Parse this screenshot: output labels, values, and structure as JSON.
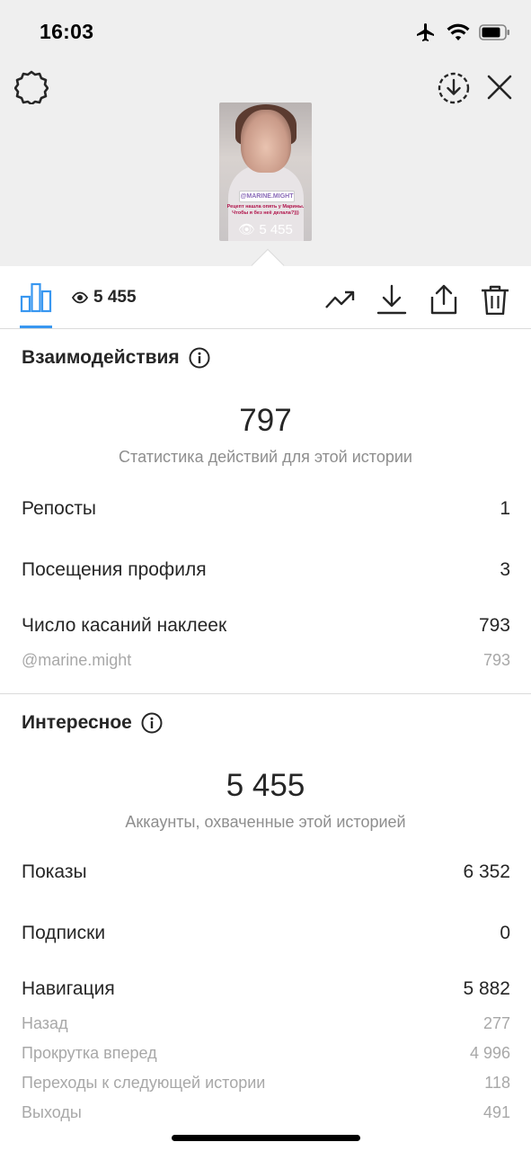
{
  "status_bar": {
    "time": "16:03"
  },
  "story": {
    "thumb_tag": "@MARINE.MIGHT",
    "thumb_caption": "Рецепт нашла опять у Марины. Чтобы я без неё делала?)))",
    "thumb_views": "5 455"
  },
  "toolbar": {
    "views": "5 455"
  },
  "interactions": {
    "title": "Взаимодействия",
    "total": "797",
    "total_label": "Статистика действий для этой истории",
    "rows": [
      {
        "label": "Репосты",
        "value": "1"
      },
      {
        "label": "Посещения профиля",
        "value": "3"
      },
      {
        "label": "Число касаний наклеек",
        "value": "793"
      }
    ],
    "sub_rows": [
      {
        "label": "@marine.might",
        "value": "793"
      }
    ]
  },
  "discovery": {
    "title": "Интересное",
    "total": "5 455",
    "total_label": "Аккаунты, охваченные этой историей",
    "rows": [
      {
        "label": "Показы",
        "value": "6 352"
      },
      {
        "label": "Подписки",
        "value": "0"
      },
      {
        "label": "Навигация",
        "value": "5 882"
      }
    ],
    "sub_rows": [
      {
        "label": "Назад",
        "value": "277"
      },
      {
        "label": "Прокрутка вперед",
        "value": "4 996"
      },
      {
        "label": "Переходы к следующей истории",
        "value": "118"
      },
      {
        "label": "Выходы",
        "value": "491"
      }
    ]
  },
  "colors": {
    "accent": "#3897f0",
    "muted": "#8e8e8e",
    "top_bg": "#efefef"
  }
}
